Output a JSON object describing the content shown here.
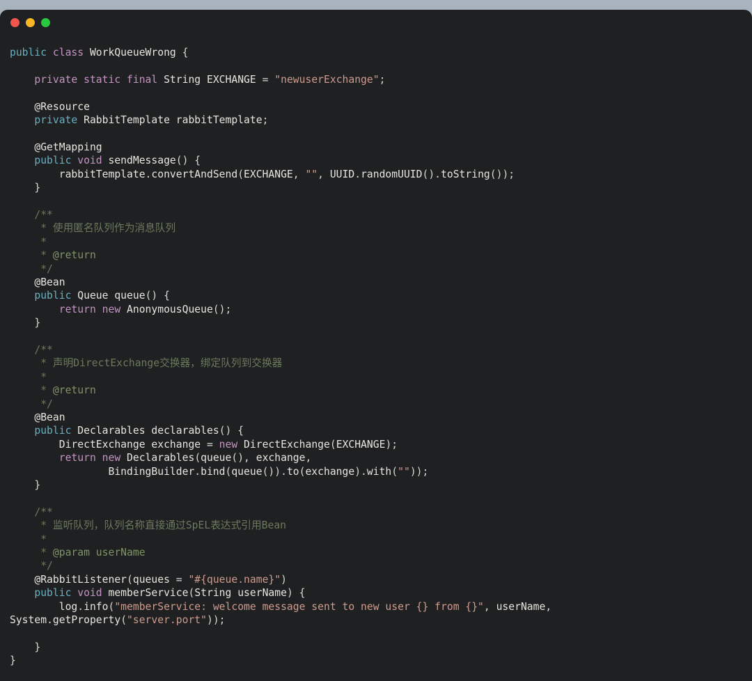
{
  "window": {
    "background_color": "#a9b3bd",
    "panel_color": "#1f2021",
    "traffic_lights": [
      {
        "name": "close",
        "color": "#f0564c"
      },
      {
        "name": "minimize",
        "color": "#f6b626"
      },
      {
        "name": "maximize",
        "color": "#2ac840"
      }
    ]
  },
  "editor": {
    "language": "java",
    "class_name": "WorkQueueWrong",
    "theme_colors": {
      "background": "#1f2021",
      "foreground": "#d8d8d2",
      "keyword_cyan": "#68b0c4",
      "keyword_magenta": "#c594c5",
      "string": "#cf9b8f",
      "comment": "#6b7a5e",
      "comment_tag": "#7f9469",
      "identifier": "#e8e6df"
    },
    "lines": [
      "public class WorkQueueWrong {",
      "",
      "    private static final String EXCHANGE = \"newuserExchange\";",
      "",
      "    @Resource",
      "    private RabbitTemplate rabbitTemplate;",
      "",
      "    @GetMapping",
      "    public void sendMessage() {",
      "        rabbitTemplate.convertAndSend(EXCHANGE, \"\", UUID.randomUUID().toString());",
      "    }",
      "",
      "    /**",
      "     * 使用匿名队列作为消息队列",
      "     *",
      "     * @return",
      "     */",
      "    @Bean",
      "    public Queue queue() {",
      "        return new AnonymousQueue();",
      "    }",
      "",
      "    /**",
      "     * 声明DirectExchange交换器，绑定队列到交换器",
      "     *",
      "     * @return",
      "     */",
      "    @Bean",
      "    public Declarables declarables() {",
      "        DirectExchange exchange = new DirectExchange(EXCHANGE);",
      "        return new Declarables(queue(), exchange,",
      "                BindingBuilder.bind(queue()).to(exchange).with(\"\"));",
      "    }",
      "",
      "    /**",
      "     * 监听队列，队列名称直接通过SpEL表达式引用Bean",
      "     *",
      "     * @param userName",
      "     */",
      "    @RabbitListener(queues = \"#{queue.name}\")",
      "    public void memberService(String userName) {",
      "        log.info(\"memberService: welcome message sent to new user {} from {}\", userName,",
      "System.getProperty(\"server.port\"));",
      "",
      "    }",
      "}"
    ],
    "comments": {
      "comment_1_text": "使用匿名队列作为消息队列",
      "comment_1_tag": "@return",
      "comment_2_text": "声明DirectExchange交换器，绑定队列到交换器",
      "comment_2_tag": "@return",
      "comment_3_text": "监听队列，队列名称直接通过SpEL表达式引用Bean",
      "comment_3_tag": "@param userName"
    },
    "annotations": [
      "@Resource",
      "@GetMapping",
      "@Bean",
      "@Bean",
      "@RabbitListener"
    ],
    "strings": [
      "\"newuserExchange\"",
      "\"\"",
      "\"\"",
      "\"#{queue.name}\"",
      "\"memberService: welcome message sent to new user {} from {}\"",
      "\"server.port\""
    ]
  }
}
